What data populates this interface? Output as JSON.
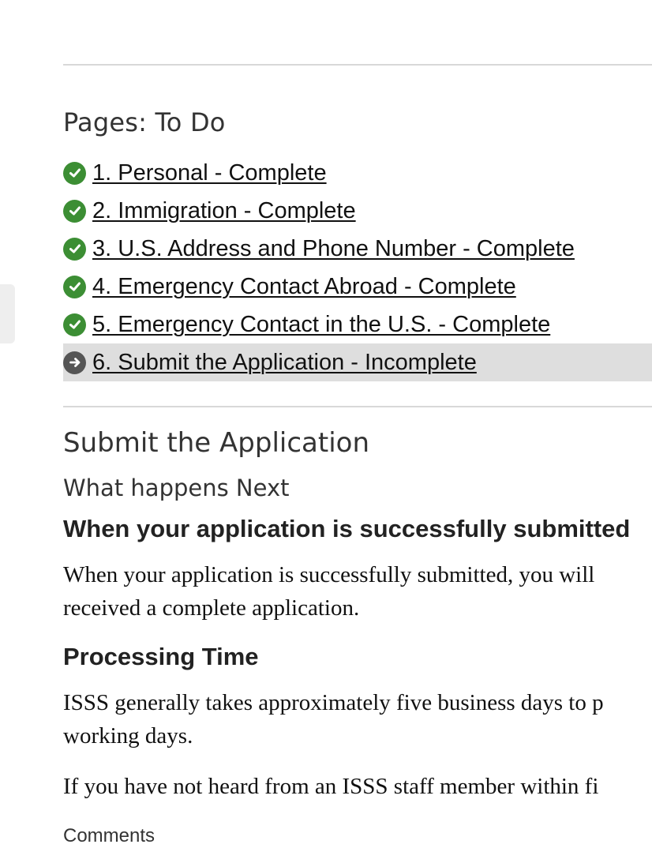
{
  "pages": {
    "heading": "Pages: To Do",
    "items": [
      {
        "label": "1. Personal - Complete",
        "status": "complete",
        "icon": "check-circle-icon"
      },
      {
        "label": "2. Immigration - Complete",
        "status": "complete",
        "icon": "check-circle-icon"
      },
      {
        "label": "3. U.S. Address and Phone Number - Complete",
        "status": "complete",
        "icon": "check-circle-icon"
      },
      {
        "label": "4. Emergency Contact Abroad - Complete",
        "status": "complete",
        "icon": "check-circle-icon"
      },
      {
        "label": "5. Emergency Contact in the U.S. - Complete",
        "status": "complete",
        "icon": "check-circle-icon"
      },
      {
        "label": "6. Submit the Application - Incomplete",
        "status": "current",
        "icon": "arrow-circle-icon"
      }
    ]
  },
  "section": {
    "title": "Submit the Application",
    "subtitle": "What happens Next",
    "blocks": [
      {
        "heading": "When your application is successfully submitted",
        "paragraphs": [
          [
            "When your application is successfully submitted, you will",
            "received a complete application."
          ]
        ]
      },
      {
        "heading": "Processing Time",
        "paragraphs": [
          [
            "ISSS generally takes approximately five business days to p",
            "working days."
          ],
          [
            "If you have not heard from an ISSS staff member within fi"
          ]
        ]
      }
    ],
    "comments_label": "Comments"
  },
  "colors": {
    "complete_icon": "#3c8e34",
    "current_icon": "#555555",
    "current_row_background": "#dedede",
    "divider": "#d8d8d8"
  }
}
